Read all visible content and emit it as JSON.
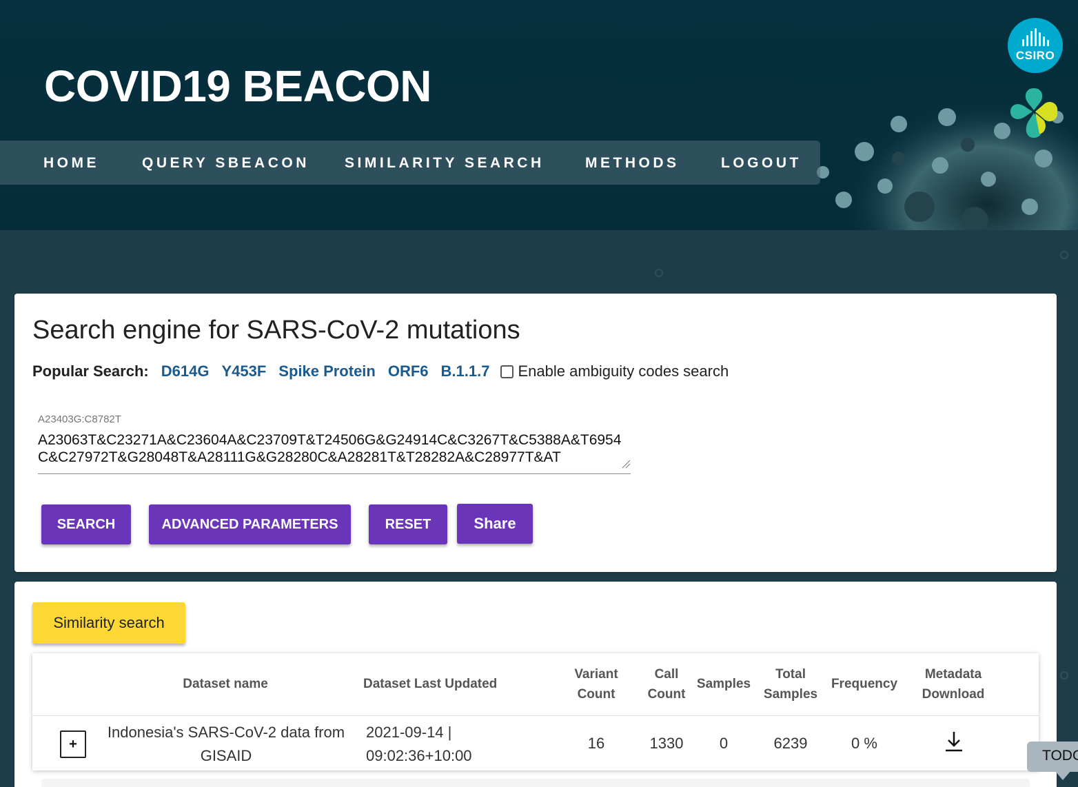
{
  "header": {
    "title": "COVID19 BEACON",
    "logo_text": "CSIRO",
    "nav": [
      "HOME",
      "QUERY SBEACON",
      "SIMILARITY SEARCH",
      "METHODS",
      "LOGOUT"
    ]
  },
  "search_card": {
    "title": "Search engine for SARS-CoV-2 mutations",
    "popular_label": "Popular Search:",
    "popular_links": [
      "D614G",
      "Y453F",
      "Spike Protein",
      "ORF6",
      "B.1.1.7"
    ],
    "ambiguity_label": "Enable ambiguity codes search",
    "ambiguity_checked": false,
    "query_label": "A23403G:C8782T",
    "query_value": "A23063T&C23271A&C23604A&C23709T&T24506G&G24914C&C3267T&C5388A&T6954C&C27972T&G28048T&A28111G&G28280C&A28281T&T28282A&C28977T&AT",
    "buttons": {
      "search": "SEARCH",
      "advanced": "ADVANCED PARAMETERS",
      "reset": "RESET",
      "share": "Share"
    }
  },
  "results_card": {
    "similarity_button": "Similarity search",
    "columns": {
      "dataset_name": "Dataset name",
      "last_updated": "Dataset Last Updated",
      "variant_count_1": "Variant",
      "variant_count_2": "Count",
      "call_count_1": "Call",
      "call_count_2": "Count",
      "samples": "Samples",
      "total_samples_1": "Total",
      "total_samples_2": "Samples",
      "frequency": "Frequency",
      "metadata_1": "Metadata",
      "metadata_2": "Download"
    },
    "rows": [
      {
        "expand": "+",
        "name_1": "Indonesia's SARS-CoV-2 data from",
        "name_2": "GISAID",
        "updated_1": "2021-09-14 |",
        "updated_2": "09:02:36+10:00",
        "variant_count": "16",
        "call_count": "1330",
        "samples": "0",
        "total_samples": "6239",
        "frequency": "0 %",
        "download_icon": "download-icon"
      }
    ]
  },
  "todo_tab": "TODO",
  "colors": {
    "header_bg": "#06303f",
    "accent_purple": "#6a35b8",
    "accent_yellow": "#fdd835",
    "link_blue": "#1a5a8c",
    "csiro_blue": "#00a9ce"
  }
}
